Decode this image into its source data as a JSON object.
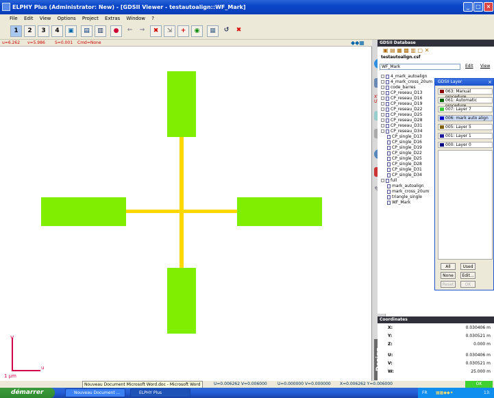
{
  "window": {
    "title": "ELPHY Plus (Administrator: New) - [GDSII Viewer - testautoalign::WF_Mark]"
  },
  "menu": [
    "File",
    "Edit",
    "View",
    "Options",
    "Project",
    "Extras",
    "Window",
    "?"
  ],
  "toolbar": {
    "b1": "1",
    "b2": "2",
    "b3": "3",
    "b4": "4"
  },
  "status_line": {
    "u": "u=6.262",
    "v": "v=5.986",
    "s": "S=0.001",
    "cmd": "Cmd=None"
  },
  "canvas": {
    "axis_v": "v",
    "axis_u": "u",
    "scale": "1 µm"
  },
  "gds_db": {
    "title": "GDSII Database",
    "file": "testautoalign.csf",
    "current": "WF_Mark",
    "edit": "Edit",
    "view": "View",
    "tree": [
      "4_mark_autoalign",
      "4_mark_cross_20um",
      "code_barres",
      "CP_reseau_D13",
      "CP_reseau_D16",
      "CP_reseau_D19",
      "CP_reseau_D22",
      "CP_reseau_D25",
      "CP_reseau_D28",
      "CP_reseau_D31",
      "CP_reseau_D34",
      "CP_single_D13",
      "CP_single_D16",
      "CP_single_D19",
      "CP_single_D22",
      "CP_single_D25",
      "CP_single_D28",
      "CP_single_D31",
      "CP_single_D34",
      "full",
      "mark_autoalign",
      "mark_cross_20um",
      "triangle_single",
      "WF_Mark"
    ]
  },
  "layer_dialog": {
    "title": "GDSII Layer",
    "layers": [
      {
        "label": "063: Manual procedure",
        "color": "#8b0000"
      },
      {
        "label": "061: Automatic procedure",
        "color": "#006400"
      },
      {
        "label": "007: Layer 7",
        "color": "#33cc33"
      },
      {
        "label": "006: mark auto align",
        "color": "#0000cc"
      },
      {
        "label": "005: Layer 5",
        "color": "#806000"
      },
      {
        "label": "001: Layer 1",
        "color": "#1a1a9a"
      },
      {
        "label": "000: Layer 0",
        "color": "#000080"
      }
    ],
    "btn_all": "All",
    "btn_used": "Used",
    "btn_none": "None",
    "btn_edit": "Edit...",
    "btn_reset": "Reset",
    "btn_ok": "OK"
  },
  "coordinates": {
    "title": "Coordinates",
    "x_label": "X:",
    "x_value": "0.030406 m",
    "y_label": "Y:",
    "y_value": "0.030521 m",
    "z_label": "Z:",
    "z_value": "0.000 m",
    "u_label": "U:",
    "u_value": "0.030406 m",
    "v_label": "V:",
    "v_value": "0.030521 m",
    "w_label": "W:",
    "w_value": "25.000 m",
    "ok": "OK"
  },
  "design_label": "Design",
  "bottom_status": {
    "tooltip": "Nouveau Document Microsoft Word.doc - Microsoft Word",
    "uv1": "U=0.006262  V=0.006000",
    "uv2": "U=0.000000  V=0.000000",
    "xy": "X=0.006262  Y=0.006000"
  },
  "taskbar": {
    "start": "démarrer",
    "task1": "Nouveau Document ...",
    "task2": "ELPHY Plus",
    "lang": "FR",
    "clock": "13:"
  },
  "colors": {
    "shape": "#80ee00",
    "line": "#ffd800",
    "axis": "#d4004a"
  }
}
